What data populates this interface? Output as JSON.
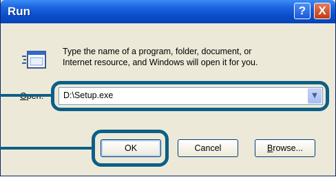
{
  "window": {
    "title": "Run",
    "help_label": "?",
    "close_label": "X"
  },
  "dialog": {
    "prompt_line1": "Type the name of a program, folder, document, or",
    "prompt_line2": "Internet resource, and Windows will open it for you.",
    "open_label_prefix": "O",
    "open_label_rest": "pen:",
    "open_value": "D:\\Setup.exe"
  },
  "buttons": {
    "ok": "OK",
    "cancel": "Cancel",
    "browse_prefix": "B",
    "browse_rest": "rowse..."
  },
  "colors": {
    "title_bar": "#0a4ecb",
    "dialog_bg": "#ece9d8",
    "callout": "#0c5f86"
  },
  "icons": [
    "run-icon",
    "help-icon",
    "close-icon",
    "chevron-down-icon"
  ]
}
